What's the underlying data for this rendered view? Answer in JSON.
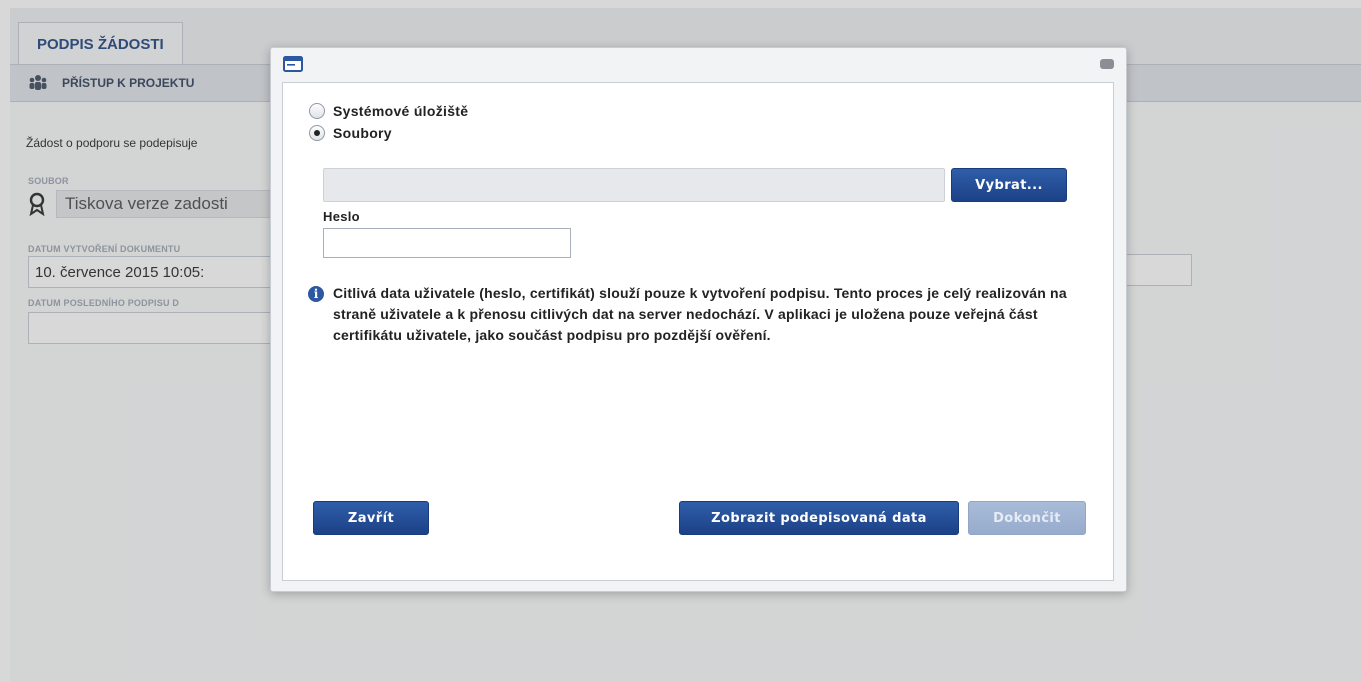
{
  "background": {
    "tab_label": "PODPIS ŽÁDOSTI",
    "section_label": "PŘÍSTUP K PROJEKTU",
    "section_icon": "people-icon",
    "intro_text": "Žádost o podporu se podepisuje",
    "file_label": "SOUBOR",
    "file_icon": "certificate-icon",
    "file_name": "Tiskova verze zadosti",
    "created_label": "DATUM VYTVOŘENÍ DOKUMENTU",
    "created_value": "10. července 2015 10:05:",
    "last_sign_label": "DATUM POSLEDNÍHO PODPISU D",
    "last_sign_value": ""
  },
  "dialog": {
    "title_icon": "window-icon",
    "close_icon": "close-icon",
    "storage_options": [
      {
        "label": "Systémové úložiště",
        "selected": false
      },
      {
        "label": "Soubory",
        "selected": true
      }
    ],
    "file_path_value": "",
    "select_button": "Vybrat...",
    "password_label": "Heslo",
    "password_value": "",
    "info_icon": "info-icon",
    "info_text": "Citlivá data uživatele (heslo, certifikát) slouží pouze k vytvoření podpisu. Tento proces je celý realizován na straně uživatele a k přenosu citlivých dat na server nedochází. V aplikaci je uložena pouze veřejná část certifikátu uživatele, jako součást podpisu pro pozdější ověření.",
    "close_button": "Zavřít",
    "show_data_button": "Zobrazit podepisovaná data",
    "finish_button": "Dokončit",
    "finish_enabled": false
  },
  "colors": {
    "primary_button": "#1f4a90",
    "disabled_button": "#a3b5d4",
    "tab_text": "#2c4f86"
  }
}
